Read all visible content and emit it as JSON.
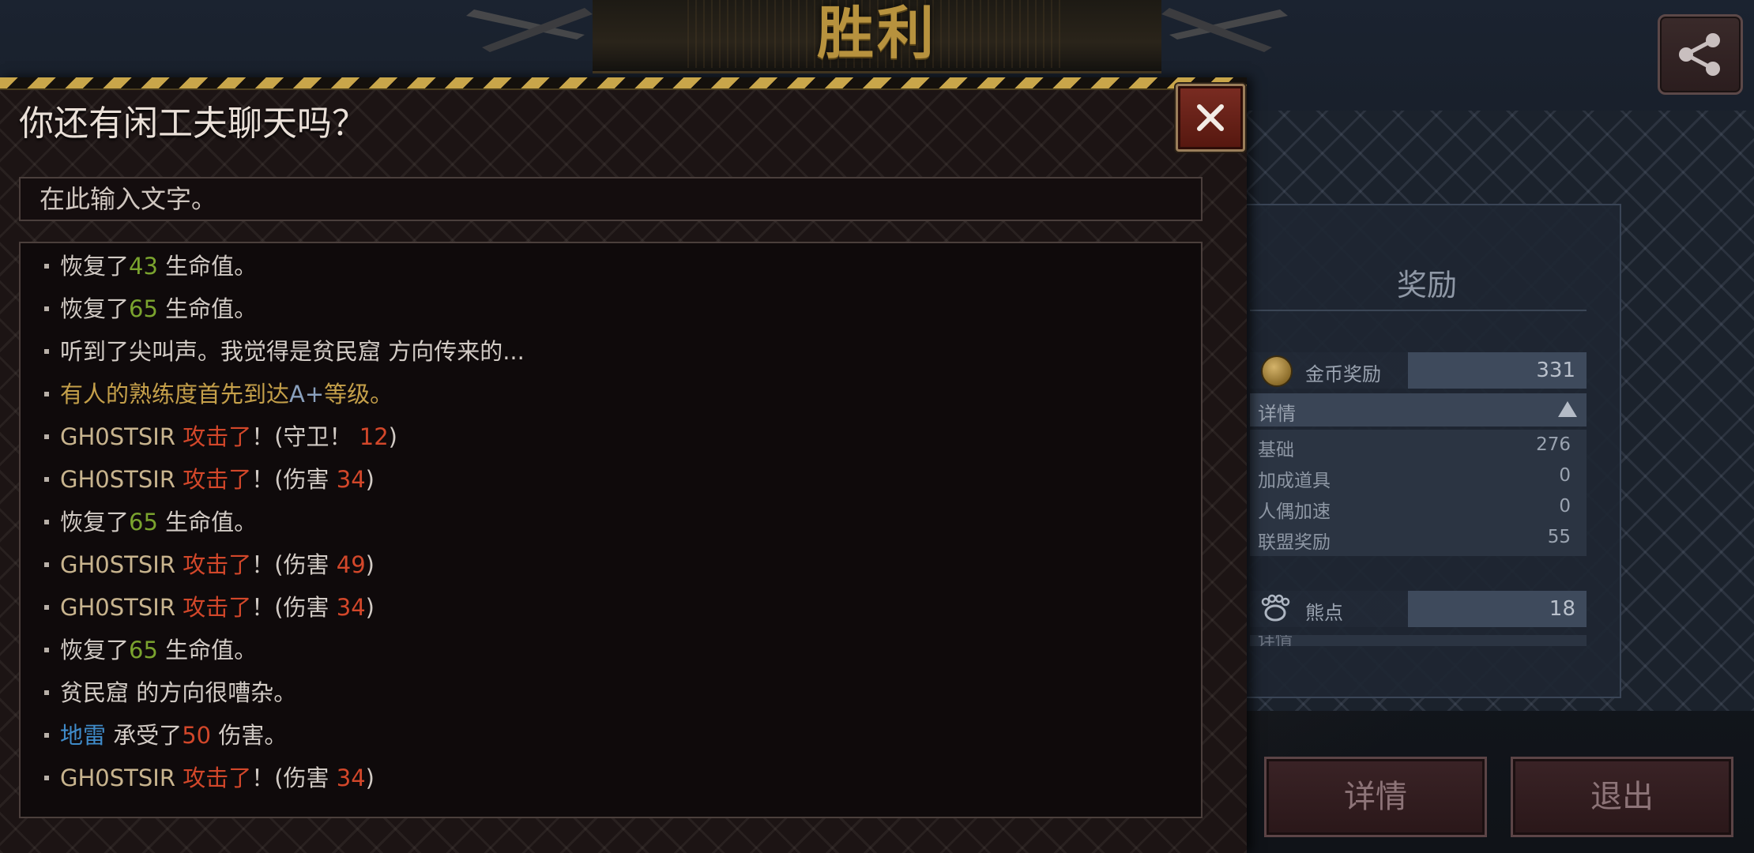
{
  "background": {
    "victory_title": "胜利",
    "reward": {
      "title": "奖励",
      "coin_label": "金币奖励",
      "coin_value": "331",
      "details_label": "详情",
      "items": [
        {
          "label": "基础",
          "value": "276"
        },
        {
          "label": "加成道具",
          "value": "0"
        },
        {
          "label": "人偶加速",
          "value": "0"
        },
        {
          "label": "联盟奖励",
          "value": "55"
        }
      ],
      "bear_label": "熊点",
      "bear_value": "18",
      "partial_label": "详情"
    },
    "buttons": {
      "details": "详情",
      "exit": "退出"
    }
  },
  "dialog": {
    "title": "你还有闲工夫聊天吗？",
    "input": {
      "placeholder": "在此输入文字。",
      "value": ""
    },
    "log": [
      [
        {
          "t": "恢复了",
          "c": "white"
        },
        {
          "t": "43",
          "c": "green"
        },
        {
          "t": " 生命值。",
          "c": "white"
        }
      ],
      [
        {
          "t": "恢复了",
          "c": "white"
        },
        {
          "t": "65",
          "c": "green"
        },
        {
          "t": " 生命值。",
          "c": "white"
        }
      ],
      [
        {
          "t": "听到了尖叫声。我觉得是贫民窟 方向传来的...",
          "c": "white"
        }
      ],
      [
        {
          "t": "有人的熟练度首先到达",
          "c": "gold"
        },
        {
          "t": "A+",
          "c": "steel"
        },
        {
          "t": "等级。",
          "c": "gold"
        }
      ],
      [
        {
          "t": "GH0STSIR  ",
          "c": "name"
        },
        {
          "t": "攻击了",
          "c": "red"
        },
        {
          "t": "！(守卫！ ",
          "c": "white"
        },
        {
          "t": "12",
          "c": "red"
        },
        {
          "t": ")",
          "c": "white"
        }
      ],
      [
        {
          "t": "GH0STSIR  ",
          "c": "name"
        },
        {
          "t": "攻击了",
          "c": "red"
        },
        {
          "t": "！(伤害 ",
          "c": "white"
        },
        {
          "t": "34",
          "c": "red"
        },
        {
          "t": ")",
          "c": "white"
        }
      ],
      [
        {
          "t": "恢复了",
          "c": "white"
        },
        {
          "t": "65",
          "c": "green"
        },
        {
          "t": " 生命值。",
          "c": "white"
        }
      ],
      [
        {
          "t": "GH0STSIR  ",
          "c": "name"
        },
        {
          "t": "攻击了",
          "c": "red"
        },
        {
          "t": "！(伤害 ",
          "c": "white"
        },
        {
          "t": "49",
          "c": "red"
        },
        {
          "t": ")",
          "c": "white"
        }
      ],
      [
        {
          "t": "GH0STSIR  ",
          "c": "name"
        },
        {
          "t": "攻击了",
          "c": "red"
        },
        {
          "t": "！(伤害 ",
          "c": "white"
        },
        {
          "t": "34",
          "c": "red"
        },
        {
          "t": ")",
          "c": "white"
        }
      ],
      [
        {
          "t": "恢复了",
          "c": "white"
        },
        {
          "t": "65",
          "c": "green"
        },
        {
          "t": " 生命值。",
          "c": "white"
        }
      ],
      [
        {
          "t": "贫民窟 的方向很嘈杂。",
          "c": "white"
        }
      ],
      [
        {
          "t": "地雷",
          "c": "blue"
        },
        {
          "t": " 承受了",
          "c": "white"
        },
        {
          "t": "50",
          "c": "red"
        },
        {
          "t": " 伤害。",
          "c": "white"
        }
      ],
      [
        {
          "t": "GH0STSIR  ",
          "c": "name"
        },
        {
          "t": "攻击了",
          "c": "red"
        },
        {
          "t": "！(伤害 ",
          "c": "white"
        },
        {
          "t": "34",
          "c": "red"
        },
        {
          "t": ")",
          "c": "white"
        }
      ]
    ]
  },
  "colors": {
    "heal_green": "#7aa32e",
    "damage_red": "#d2472a",
    "gold_text": "#c5a04a",
    "mine_blue": "#3f8bc9",
    "hazard_yellow": "#c9a64a"
  },
  "icons": {
    "close": "close-icon",
    "share": "share-icon",
    "coin": "coin-icon",
    "bear": "bear-paw-icon",
    "collapse": "triangle-up-icon"
  }
}
